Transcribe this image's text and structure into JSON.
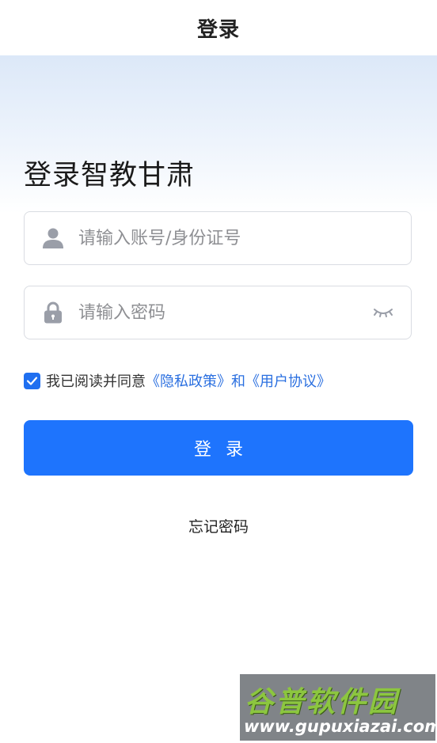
{
  "navbar": {
    "title": "登录"
  },
  "main": {
    "heading": "登录智教甘肃"
  },
  "form": {
    "account_placeholder": "请输入账号/身份证号",
    "account_value": "",
    "password_placeholder": "请输入密码",
    "password_value": "",
    "agreement": {
      "checked": true,
      "text": "我已阅读并同意",
      "privacy_link": "《隐私政策》",
      "and_text": "和",
      "user_link": "《用户协议》"
    },
    "login_button": "登录",
    "forgot_link": "忘记密码"
  },
  "watermark": {
    "title": "谷普软件园",
    "url": "www.gupuxiazai.com"
  },
  "colors": {
    "primary": "#1e74fd",
    "link": "#2a6fe0",
    "border": "#d9dce2",
    "placeholder": "#8e8f93",
    "icon": "#9a9ea8"
  },
  "icons": {
    "account": "user-icon",
    "password": "lock-icon",
    "toggle": "eye-closed-icon",
    "checkbox": "check-icon"
  }
}
